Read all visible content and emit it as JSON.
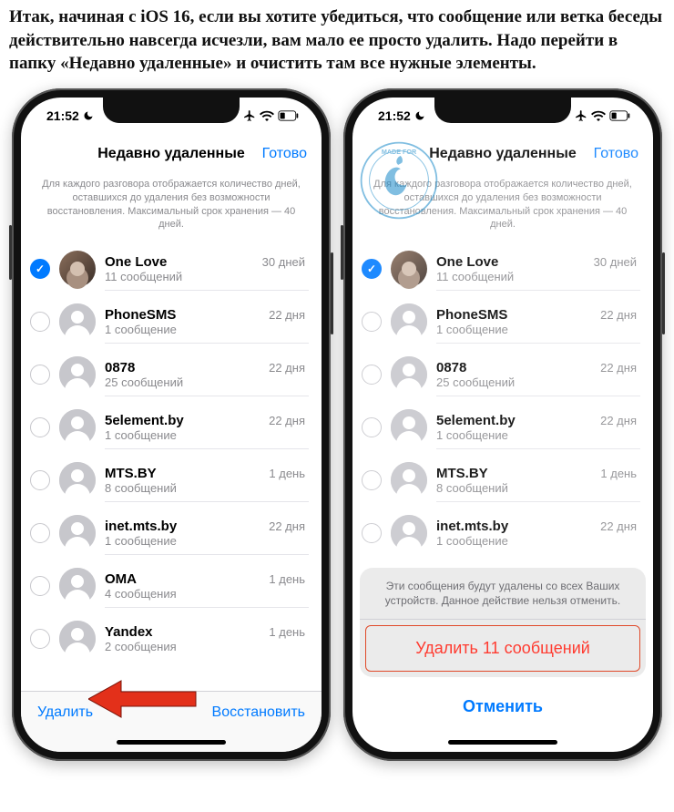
{
  "article": "Итак, начиная с iOS 16, если вы хотите убедиться, что сообщение или ветка беседы действительно навсегда исчезли, вам мало ее просто удалить. Надо перейти в папку «Недавно удаленные» и очистить там все нужные элементы.",
  "statusbar": {
    "time": "21:52"
  },
  "header": {
    "title": "Недавно удаленные",
    "done": "Готово"
  },
  "info": "Для каждого разговора отображается количество дней, оставшихся до удаления без возможности восстановления. Максимальный срок хранения — 40 дней.",
  "conversations": [
    {
      "name": "One Love",
      "sub": "11 сообщений",
      "days": "30 дней",
      "selected": true,
      "photo": true
    },
    {
      "name": "PhoneSMS",
      "sub": "1 сообщение",
      "days": "22 дня",
      "selected": false,
      "photo": false
    },
    {
      "name": "0878",
      "sub": "25 сообщений",
      "days": "22 дня",
      "selected": false,
      "photo": false
    },
    {
      "name": "5element.by",
      "sub": "1 сообщение",
      "days": "22 дня",
      "selected": false,
      "photo": false
    },
    {
      "name": "MTS.BY",
      "sub": "8 сообщений",
      "days": "1 день",
      "selected": false,
      "photo": false
    },
    {
      "name": "inet.mts.by",
      "sub": "1 сообщение",
      "days": "22 дня",
      "selected": false,
      "photo": false
    },
    {
      "name": "OMA",
      "sub": "4 сообщения",
      "days": "1 день",
      "selected": false,
      "photo": false
    },
    {
      "name": "Yandex",
      "sub": "2 сообщения",
      "days": "1 день",
      "selected": false,
      "photo": false
    }
  ],
  "toolbar": {
    "delete": "Удалить",
    "restore": "Восстановить"
  },
  "sheet": {
    "message": "Эти сообщения будут удалены со всех Ваших устройств. Данное действие нельзя отменить.",
    "delete": "Удалить 11 сообщений",
    "cancel": "Отменить"
  },
  "watermark": "MADE FOR iPHONE iPAD USER"
}
